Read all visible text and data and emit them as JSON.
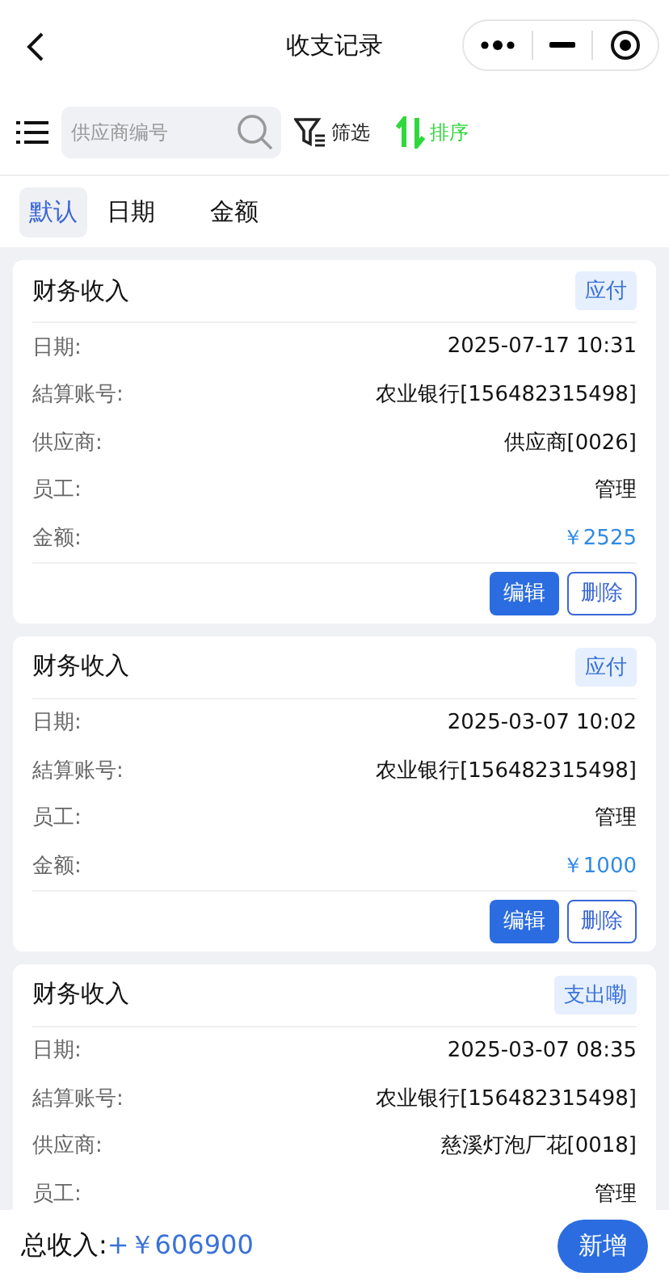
{
  "header": {
    "title": "收支记录"
  },
  "toolbar": {
    "search": {
      "placeholder": "供应商编号"
    },
    "filter": "筛选",
    "sort": "排序"
  },
  "tabs": [
    {
      "label": "默认",
      "selected": true
    },
    {
      "label": "日期",
      "selected": false
    },
    {
      "label": "金额",
      "selected": false
    }
  ],
  "records": [
    {
      "title": "财务收入",
      "tag": "应付",
      "fields": [
        {
          "kind": "text",
          "label": "日期:",
          "value": "2025-07-17 10:31"
        },
        {
          "kind": "text",
          "label": "結算账号:",
          "value": "农业银行[156482315498]"
        },
        {
          "kind": "text",
          "label": "供应商:",
          "value": "供应商[0026]"
        },
        {
          "kind": "text",
          "label": "员工:",
          "value": "管理"
        },
        {
          "kind": "amount",
          "label": "金额:",
          "value": "￥2525"
        }
      ],
      "actions": [
        "编辑",
        "删除"
      ]
    },
    {
      "title": "财务收入",
      "tag": "应付",
      "fields": [
        {
          "kind": "text",
          "label": "日期:",
          "value": "2025-03-07 10:02"
        },
        {
          "kind": "text",
          "label": "結算账号:",
          "value": "农业银行[156482315498]"
        },
        {
          "kind": "text",
          "label": "员工:",
          "value": "管理"
        },
        {
          "kind": "amount",
          "label": "金额:",
          "value": "￥1000"
        }
      ],
      "actions": [
        "编辑",
        "删除"
      ]
    },
    {
      "title": "财务收入",
      "tag": "支出嘞",
      "fields": [
        {
          "kind": "text",
          "label": "日期:",
          "value": "2025-03-07 08:35"
        },
        {
          "kind": "text",
          "label": "結算账号:",
          "value": "农业银行[156482315498]"
        },
        {
          "kind": "text",
          "label": "供应商:",
          "value": "慈溪灯泡厂花[0018]"
        },
        {
          "kind": "text",
          "label": "员工:",
          "value": "管理"
        }
      ]
    }
  ],
  "footer": {
    "label": "总收入:",
    "total": "+￥606900",
    "add_button": "新增"
  }
}
